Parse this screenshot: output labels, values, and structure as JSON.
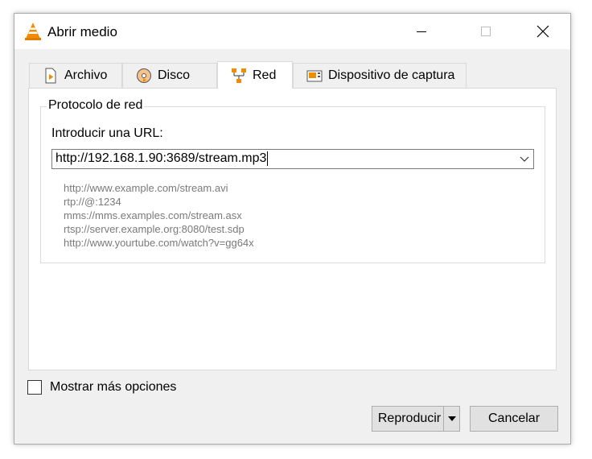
{
  "window": {
    "title": "Abrir medio"
  },
  "tabs": [
    {
      "label": "Archivo"
    },
    {
      "label": "Disco"
    },
    {
      "label": "Red"
    },
    {
      "label": "Dispositivo de captura"
    }
  ],
  "network": {
    "group_title": "Protocolo de red",
    "url_label": "Introducir una URL:",
    "url_value": "http://192.168.1.90:3689/stream.mp3",
    "examples": [
      "http://www.example.com/stream.avi",
      "rtp://@:1234",
      "mms://mms.examples.com/stream.asx",
      "rtsp://server.example.org:8080/test.sdp",
      "http://www.yourtube.com/watch?v=gg64x"
    ]
  },
  "options": {
    "show_more_label": "Mostrar más opciones",
    "show_more_checked": false
  },
  "buttons": {
    "play_label": "Reproducir",
    "cancel_label": "Cancelar"
  },
  "colors": {
    "accent_orange": "#f08c00",
    "window_bg": "#f0f0f0",
    "hint_text": "#7a7a7a"
  }
}
